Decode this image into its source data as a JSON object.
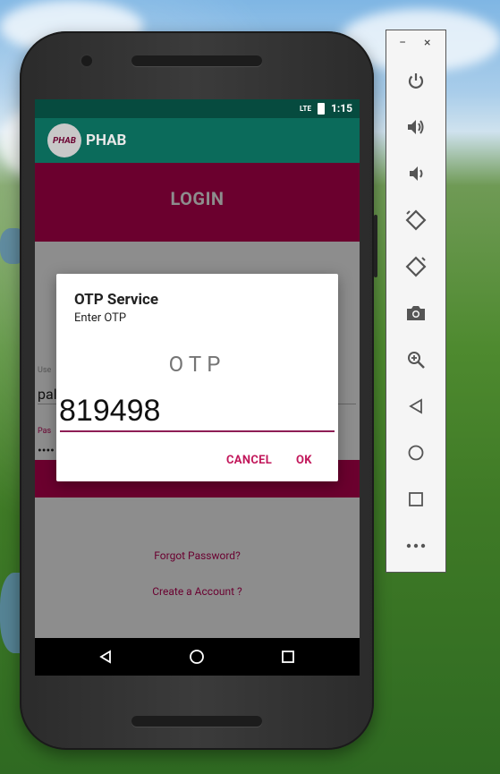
{
  "status": {
    "network": "LTE",
    "time": "1:15"
  },
  "app": {
    "title": "PHAB",
    "logo_text": "PHAB"
  },
  "login": {
    "header": "LOGIN",
    "username_label": "Use",
    "username_value": "pal",
    "password_label": "Pas",
    "password_value": "••••",
    "forgot_link": "Forgot Password?",
    "create_link": "Create a Account ?"
  },
  "dialog": {
    "title": "OTP Service",
    "message": "Enter OTP",
    "hint": "OTP",
    "input_value": "819498",
    "cancel_label": "CANCEL",
    "ok_label": "OK"
  },
  "colors": {
    "statusbar": "#064b3f",
    "appbar": "#0b6b5b",
    "primary_dark": "#6b002e",
    "accent": "#c2185b"
  },
  "emulator_tools": [
    "power-icon",
    "volume-up-icon",
    "volume-down-icon",
    "rotate-left-icon",
    "rotate-right-icon",
    "camera-icon",
    "zoom-icon",
    "back-icon",
    "home-icon",
    "overview-icon",
    "more-icon"
  ],
  "window_controls": {
    "minimize": "−",
    "close": "×"
  }
}
